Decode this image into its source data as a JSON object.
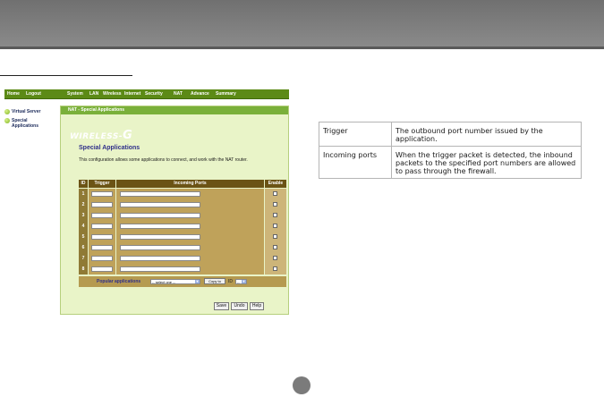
{
  "router": {
    "menu": [
      "Home",
      "Logout",
      "System",
      "LAN",
      "Wireless",
      "Internet",
      "Security",
      "NAT",
      "Advance",
      "Summary"
    ],
    "nav": [
      "Virtual Server",
      "Special Applications"
    ],
    "panel_title": "NAT - Special Applications",
    "logo_prefix": "WIRELESS-",
    "logo_suffix": "G",
    "heading": "Special Applications",
    "description": "This configuration allows some applications to connect, and work with the NAT router.",
    "columns": [
      "ID",
      "Trigger",
      "Incoming Ports",
      "Enable"
    ],
    "row_ids": [
      "1",
      "2",
      "3",
      "4",
      "5",
      "6",
      "7",
      "8"
    ],
    "popular_label": "Popular applications",
    "popular_select": "-- select one --",
    "copy_to": "Copy to",
    "id_label": "ID",
    "id_select": "--",
    "buttons": {
      "save": "Save",
      "undo": "Undo",
      "help": "Help"
    }
  },
  "descriptions": [
    {
      "term": "Trigger",
      "text": "The outbound port number issued by the application."
    },
    {
      "term": "Incoming ports",
      "text": "When the trigger packet is detected, the inbound packets to the specified port numbers are allowed to pass through the firewall."
    }
  ],
  "colors": {
    "menubar": "#5c8a16",
    "panel": "#e9f4c8",
    "grid_header": "#6b5315",
    "top_band": "#7a7a7a"
  }
}
